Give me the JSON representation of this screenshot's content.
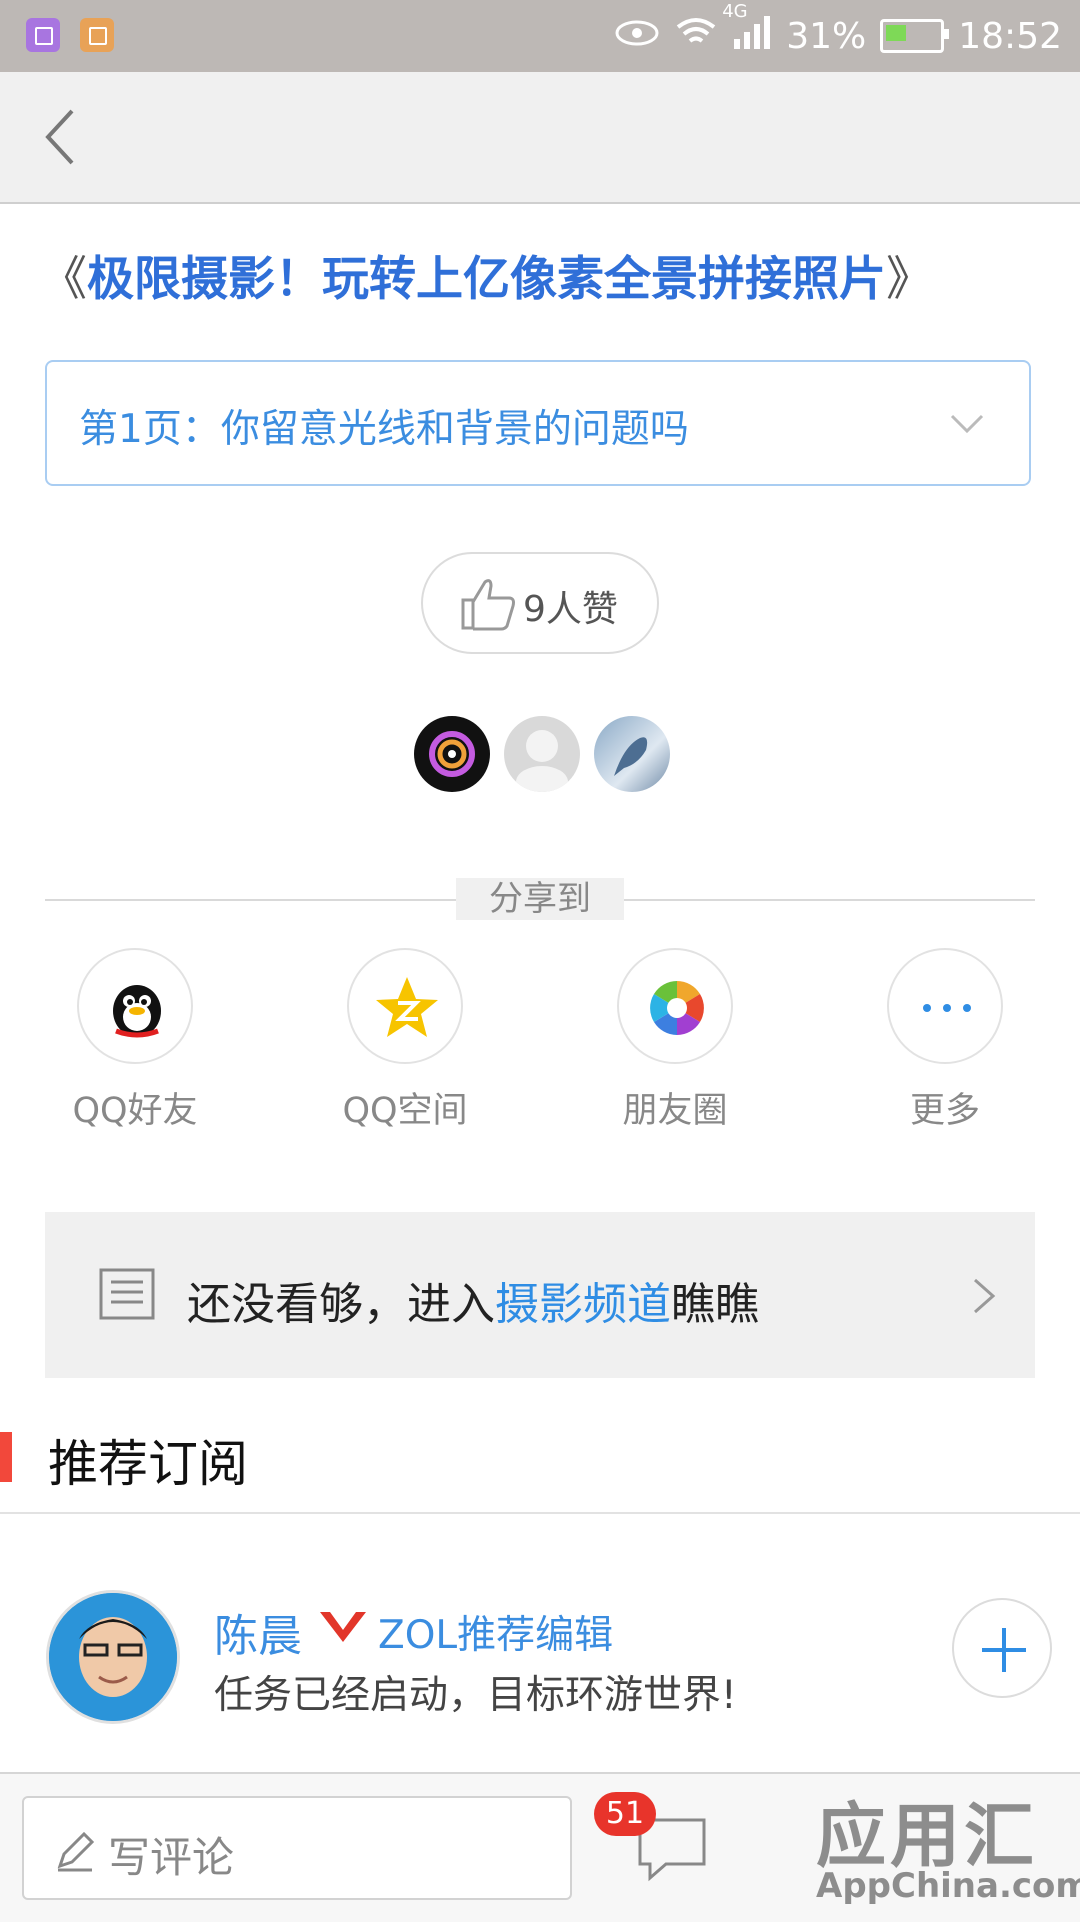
{
  "status_bar": {
    "network": "4G",
    "battery_percent": "31%",
    "time": "18:52"
  },
  "nav": {
    "back": "back"
  },
  "article": {
    "title_open": "《",
    "title": "极限摄影！玩转上亿像素全景拼接照片",
    "title_close": "》"
  },
  "page_selector": {
    "label": "第1页：你留意光线和背景的问题吗"
  },
  "like": {
    "count_label": "9人赞"
  },
  "share": {
    "heading": "分享到",
    "targets": [
      {
        "label": "QQ好友",
        "icon": "qq-penguin-icon"
      },
      {
        "label": "QQ空间",
        "icon": "qzone-star-icon"
      },
      {
        "label": "朋友圈",
        "icon": "moments-shutter-icon"
      },
      {
        "label": "更多",
        "icon": "more-dots-icon"
      }
    ]
  },
  "channel_banner": {
    "prefix": "还没看够，进入",
    "highlight": "摄影频道",
    "suffix": "瞧瞧"
  },
  "recommend": {
    "heading": "推荐订阅",
    "author": {
      "name": "陈晨",
      "role": "ZOL推荐编辑",
      "desc": "任务已经启动，目标环游世界!"
    }
  },
  "bottom_bar": {
    "comment_placeholder": "写评论",
    "comment_count": "51"
  },
  "watermark": {
    "text": "应用汇",
    "sub": "AppChina.com"
  },
  "colors": {
    "accent_blue": "#2f8de4",
    "title_blue": "#2f6fd8",
    "section_red": "#f2483b",
    "badge_red": "#e8342b"
  }
}
